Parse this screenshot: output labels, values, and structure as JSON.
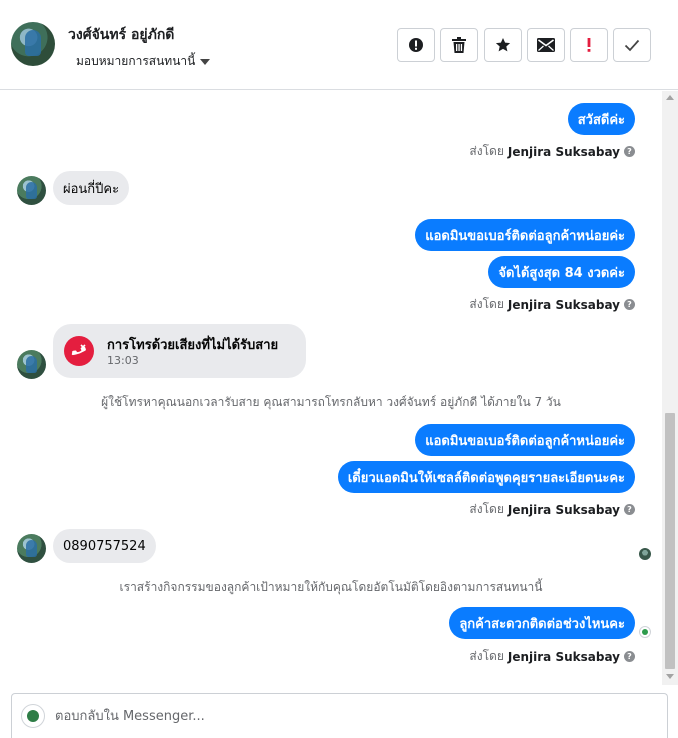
{
  "header": {
    "contact_name": "วงศ์จันทร์ อยู่ภักดี",
    "assign_label": "มอบหมายการสนทนานี้",
    "toolbar": [
      {
        "name": "info-button",
        "icon": "alert-circle-icon"
      },
      {
        "name": "delete-button",
        "icon": "trash-icon"
      },
      {
        "name": "star-button",
        "icon": "star-icon"
      },
      {
        "name": "mark-unread-button",
        "icon": "envelope-icon"
      },
      {
        "name": "follow-up-button",
        "icon": "exclamation-icon",
        "accent": "#e41e3f"
      },
      {
        "name": "mark-done-button",
        "icon": "check-icon"
      }
    ]
  },
  "messages": {
    "m1": "สวัสดีค่ะ",
    "m2": "ผ่อนกี่ปีคะ",
    "m3": "แอดมินขอเบอร์ติดต่อลูกค้าหน่อยค่ะ",
    "m4": "จัดได้สูงสุด 84 งวดค่ะ",
    "m5": "แอดมินขอเบอร์ติดต่อลูกค้าหน่อยค่ะ",
    "m6": "เดี๋ยวแอดมินให้เซลล์ติดต่อพูดคุยรายละเอียดนะคะ",
    "m7": "0890757524",
    "m8": "ลูกค้าสะดวกติดต่อช่วงไหนคะ"
  },
  "sent_by": {
    "prefix": "ส่งโดย",
    "agent": "Jenjira Suksabay",
    "help": "?"
  },
  "missed_call": {
    "title": "การโทรด้วยเสียงที่ไม่ได้รับสาย",
    "time": "13:03",
    "note": "ผู้ใช้โทรหาคุณนอกเวลารับสาย คุณสามารถโทรกลับหา วงศ์จันทร์ อยู่ภักดี ได้ภายใน 7 วัน"
  },
  "system_note": "เราสร้างกิจกรรมของลูกค้าเป้าหมายให้กับคุณโดยอัตโนมัติโดยอิงตามการสนทนานี้",
  "composer": {
    "placeholder": "ตอบกลับใน Messenger..."
  },
  "colors": {
    "outgoing": "#0a7cff",
    "incoming": "#e9eaed",
    "missed_call": "#e41e3f"
  }
}
